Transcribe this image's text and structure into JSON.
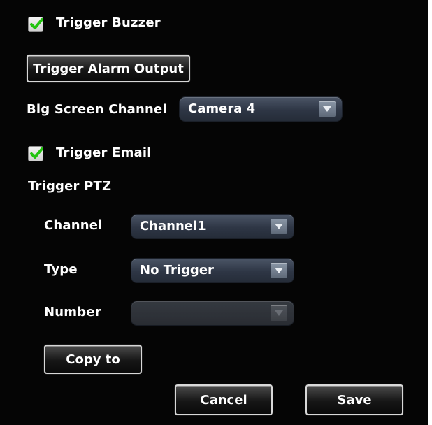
{
  "trigger_buzzer": {
    "label": "Trigger Buzzer",
    "checked": true
  },
  "trigger_alarm_output_button": "Trigger Alarm Output",
  "big_screen_channel": {
    "label": "Big Screen Channel",
    "value": "Camera 4"
  },
  "trigger_email": {
    "label": "Trigger Email",
    "checked": true
  },
  "trigger_ptz": {
    "heading": "Trigger PTZ",
    "channel": {
      "label": "Channel",
      "value": "Channel1"
    },
    "type": {
      "label": "Type",
      "value": "No Trigger"
    },
    "number": {
      "label": "Number",
      "value": ""
    }
  },
  "copy_to_button": "Copy to",
  "cancel_button": "Cancel",
  "save_button": "Save",
  "colors": {
    "panel_background": "#050505",
    "checkmark": "#22c40f",
    "select_background": "#2e3645"
  },
  "icons": {
    "checkbox_check": "checkmark-icon",
    "dropdown_arrow": "chevron-down-icon"
  }
}
